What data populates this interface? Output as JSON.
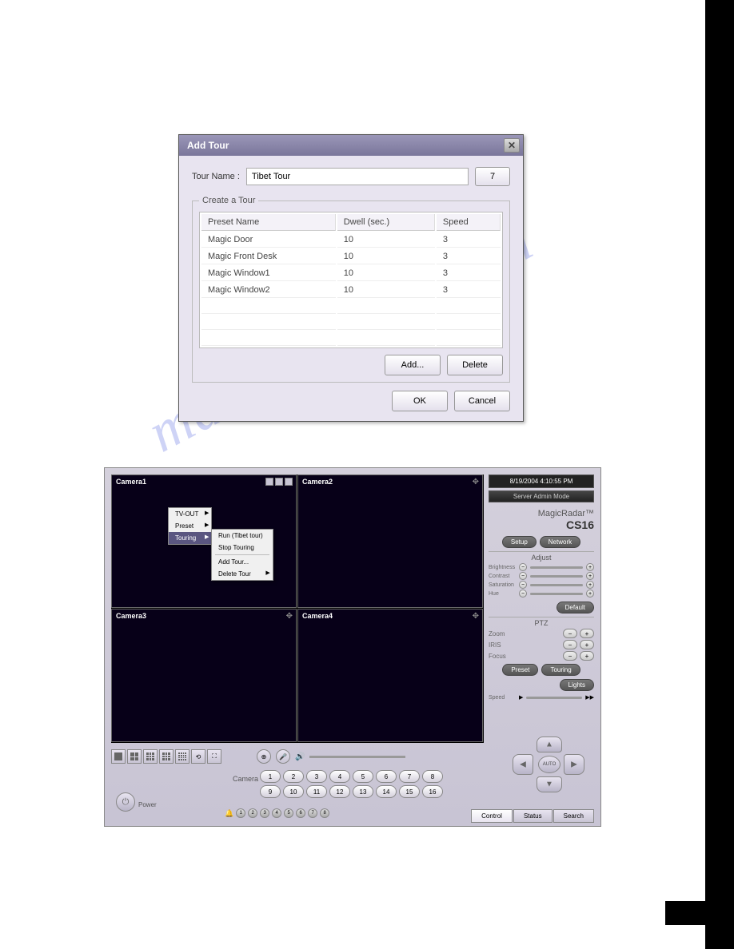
{
  "dialog": {
    "title": "Add Tour",
    "tour_name_label": "Tour Name :",
    "tour_name_value": "Tibet Tour",
    "num_button": "7",
    "fieldset_label": "Create a Tour",
    "headers": {
      "preset": "Preset Name",
      "dwell": "Dwell (sec.)",
      "speed": "Speed"
    },
    "rows": [
      {
        "name": "Magic Door",
        "dwell": "10",
        "speed": "3"
      },
      {
        "name": "Magic Front Desk",
        "dwell": "10",
        "speed": "3"
      },
      {
        "name": "Magic Window1",
        "dwell": "10",
        "speed": "3"
      },
      {
        "name": "Magic Window2",
        "dwell": "10",
        "speed": "3"
      }
    ],
    "add": "Add...",
    "delete": "Delete",
    "ok": "OK",
    "cancel": "Cancel"
  },
  "app": {
    "cameras": [
      "Camera1",
      "Camera2",
      "Camera3",
      "Camera4"
    ],
    "ctx": {
      "items": [
        "TV-OUT",
        "Preset",
        "Touring"
      ],
      "sub": [
        "Run (Tibet tour)",
        "Stop Touring",
        "Add Tour...",
        "Delete Tour"
      ]
    },
    "datetime": "8/19/2004 4:10:55 PM",
    "mode": "Server Admin Mode",
    "brand": "MagicRadar™",
    "model": "CS16",
    "setup": "Setup",
    "network": "Network",
    "adjust": "Adjust",
    "sliders": [
      "Brightness",
      "Contrast",
      "Saturation",
      "Hue"
    ],
    "default": "Default",
    "ptz_label": "PTZ",
    "ptz": {
      "zoom": "Zoom",
      "iris": "IRIS",
      "focus": "Focus"
    },
    "preset_btn": "Preset",
    "touring_btn": "Touring",
    "lights_btn": "Lights",
    "speed_label": "Speed",
    "auto": "AUTO",
    "camera_label": "Camera",
    "cam_nums": [
      "1",
      "2",
      "3",
      "4",
      "5",
      "6",
      "7",
      "8",
      "9",
      "10",
      "11",
      "12",
      "13",
      "14",
      "15",
      "16"
    ],
    "power": "Power",
    "alarm_nums": [
      "1",
      "2",
      "3",
      "4",
      "5",
      "6",
      "7",
      "8"
    ],
    "tabs": {
      "control": "Control",
      "status": "Status",
      "search": "Search"
    }
  },
  "watermark": "manualshive.com"
}
